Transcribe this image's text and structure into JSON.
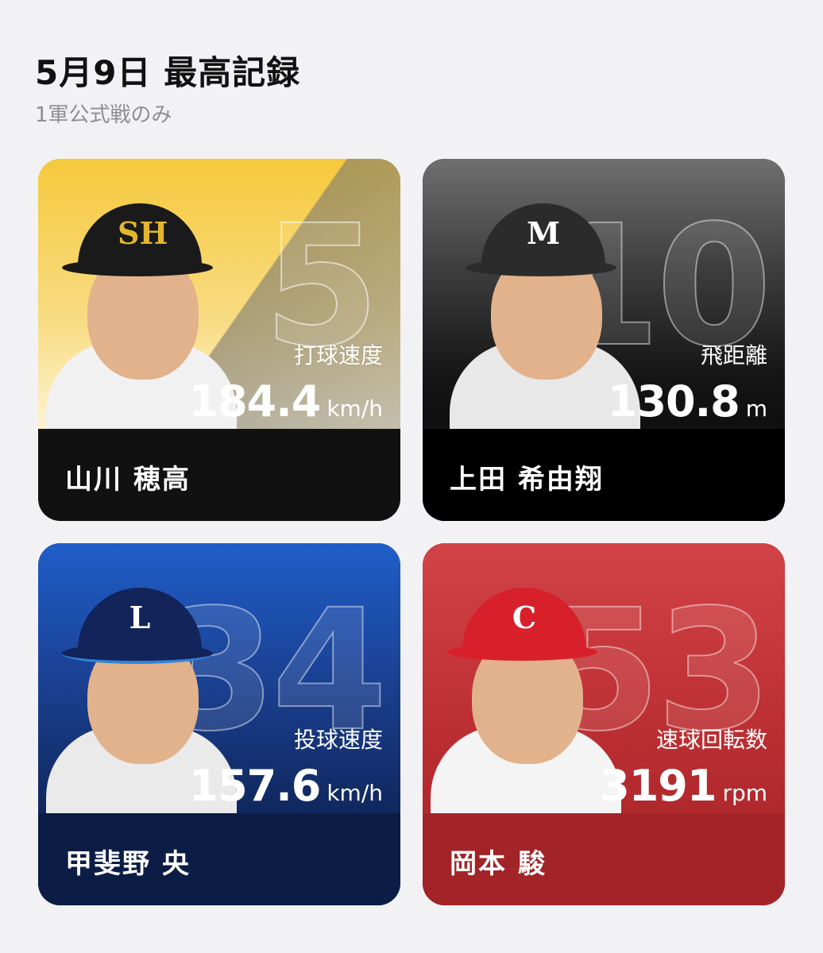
{
  "header": {
    "title": "5月9日 最高記録",
    "subtitle": "1軍公式戦のみ"
  },
  "cards": [
    {
      "uniform_number": "5",
      "cap_logo": "SH",
      "metric_label": "打球速度",
      "metric_value": "184.4",
      "metric_unit": "km/h",
      "player_name": "山川 穂高",
      "theme_color": "#f5c83f"
    },
    {
      "uniform_number": "10",
      "cap_logo": "M",
      "metric_label": "飛距離",
      "metric_value": "130.8",
      "metric_unit": "m",
      "player_name": "上田 希由翔",
      "theme_color": "#111111"
    },
    {
      "uniform_number": "34",
      "cap_logo": "L",
      "metric_label": "投球速度",
      "metric_value": "157.6",
      "metric_unit": "km/h",
      "player_name": "甲斐野 央",
      "theme_color": "#1b2d63"
    },
    {
      "uniform_number": "53",
      "cap_logo": "C",
      "metric_label": "速球回転数",
      "metric_value": "3191",
      "metric_unit": "rpm",
      "player_name": "岡本 駿",
      "theme_color": "#b3262b"
    }
  ]
}
